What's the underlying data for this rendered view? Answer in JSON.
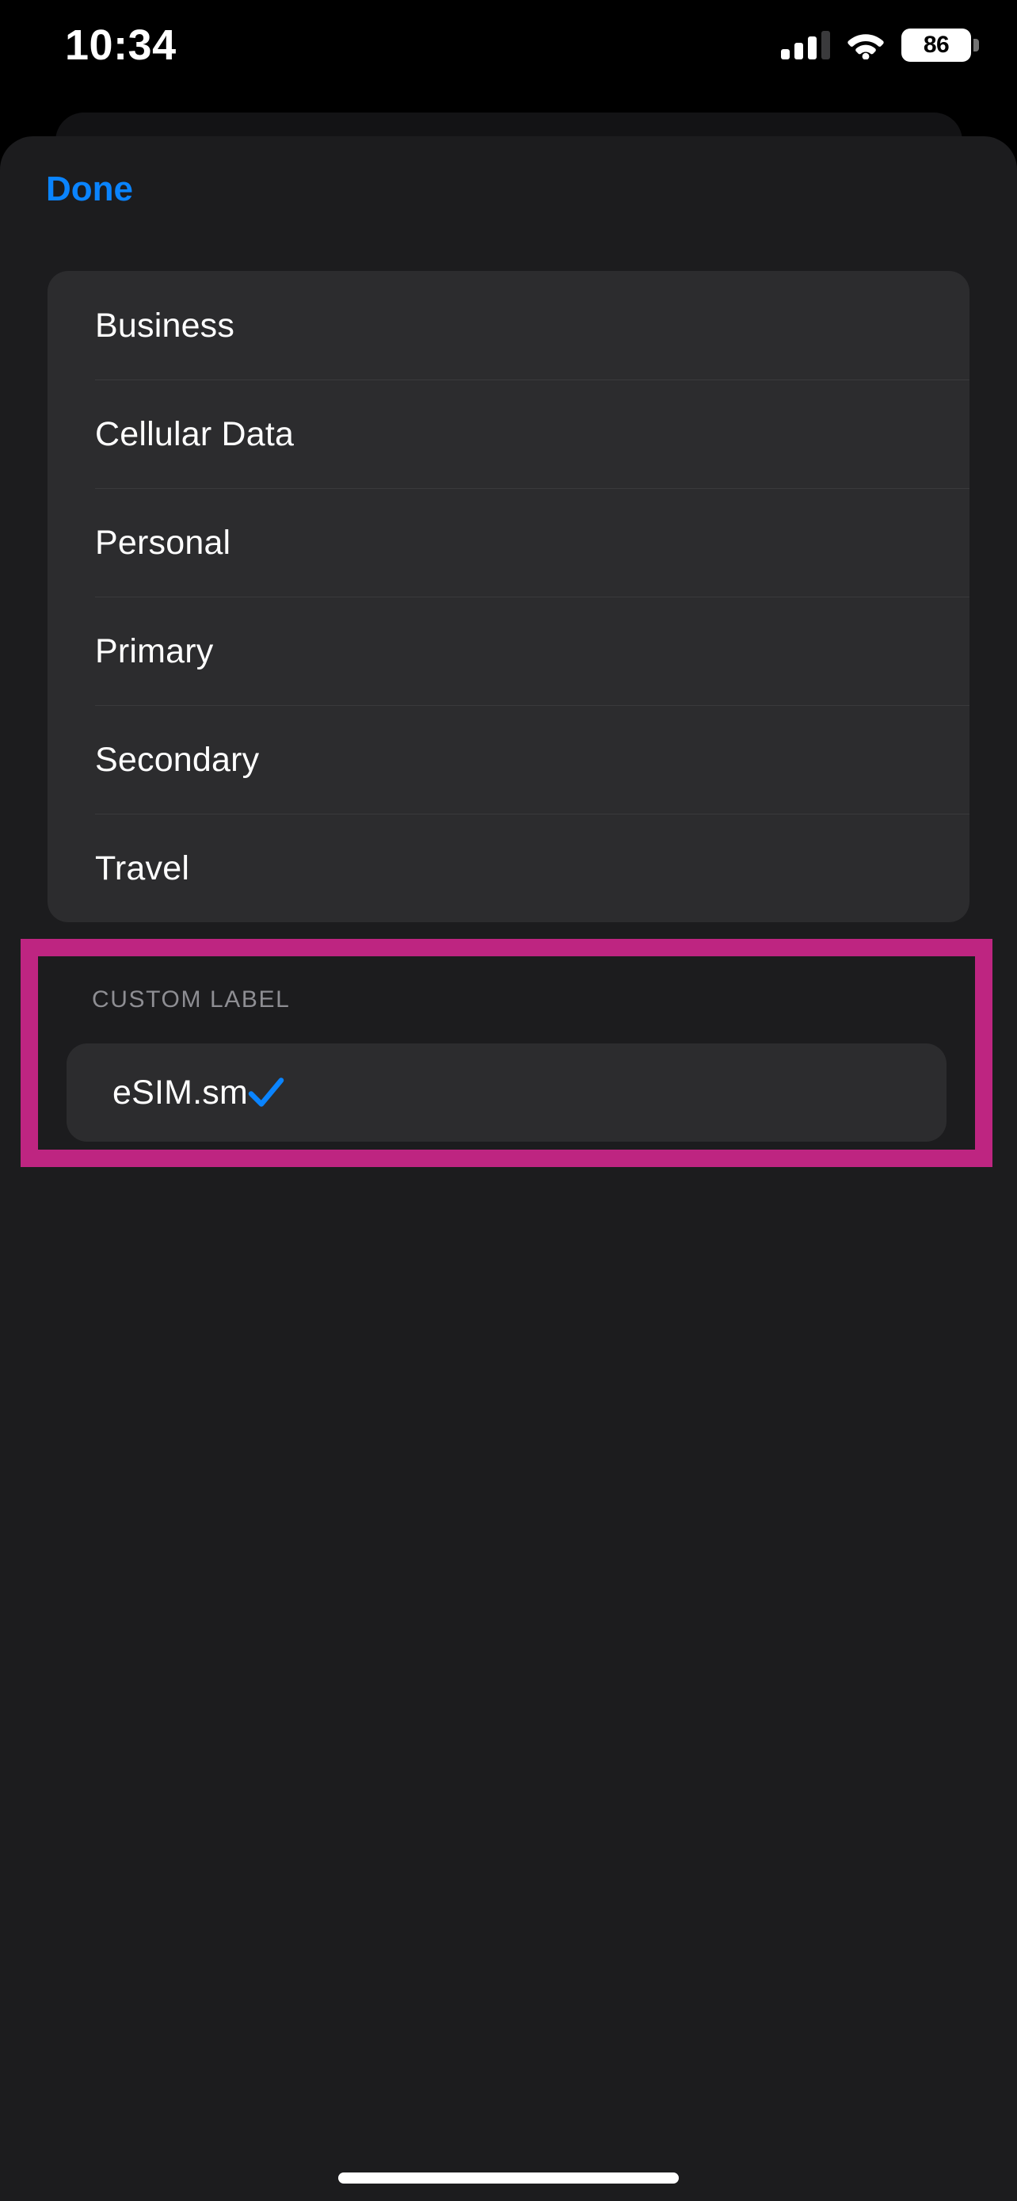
{
  "status_bar": {
    "time": "10:34",
    "cellular_icon": "cellular-bars-icon",
    "cellular_bars_active": 3,
    "cellular_bars_total": 4,
    "wifi_icon": "wifi-icon",
    "battery_icon": "battery-icon",
    "battery_percent": "86"
  },
  "sheet": {
    "done_label": "Done"
  },
  "options": {
    "items": [
      {
        "label": "Business"
      },
      {
        "label": "Cellular Data"
      },
      {
        "label": "Personal"
      },
      {
        "label": "Primary"
      },
      {
        "label": "Secondary"
      },
      {
        "label": "Travel"
      }
    ]
  },
  "custom_label_section": {
    "heading": "CUSTOM LABEL",
    "value": "eSIM.sm",
    "checkmark_icon": "checkmark-icon",
    "selected": true,
    "highlight_color": "#BE2581"
  },
  "colors": {
    "accent_blue": "#0A84FF",
    "sheet_background": "#1C1C1E",
    "card_background": "#2C2C2E",
    "separator": "#3A3A3C",
    "secondary_text": "#8E8E93",
    "highlight": "#BE2581"
  },
  "home_indicator": {
    "name": "home-indicator"
  }
}
